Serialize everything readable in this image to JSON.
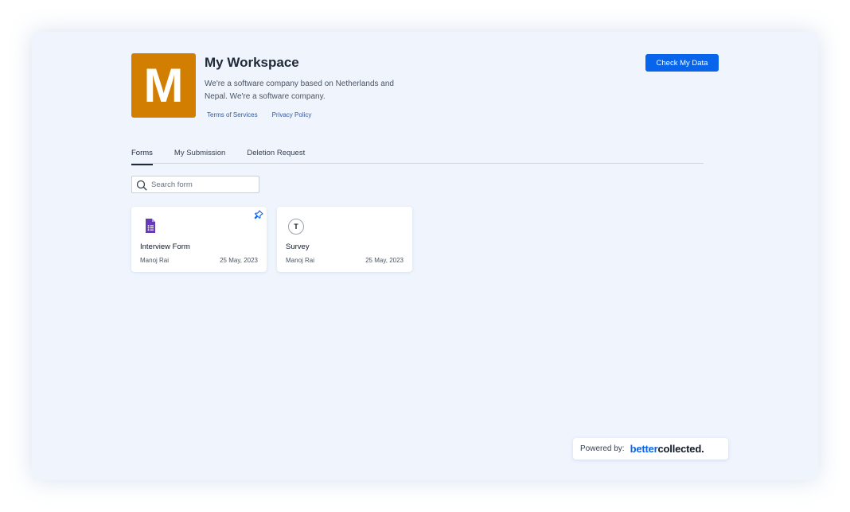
{
  "workspace": {
    "logo_letter": "M",
    "title": "My Workspace",
    "description": "We're a software company based on Netherlands and Nepal. We're a software company.",
    "terms_link": "Terms of Services",
    "privacy_link": "Privacy Policy",
    "cta_label": "Check My Data",
    "logo_color": "#d27e00"
  },
  "tabs": [
    {
      "label": "Forms",
      "active": true
    },
    {
      "label": "My Submission",
      "active": false
    },
    {
      "label": "Deletion Request",
      "active": false
    }
  ],
  "search": {
    "placeholder": "Search form",
    "value": "",
    "icon": "search-icon"
  },
  "forms": [
    {
      "title": "Interview Form",
      "author": "Manoj Rai",
      "date": "25 May, 2023",
      "provider_icon": "google-forms-icon",
      "pinned": true
    },
    {
      "title": "Survey",
      "author": "Manoj Rai",
      "date": "25 May, 2023",
      "provider_icon": "typeform-icon",
      "provider_letter": "T",
      "pinned": false
    }
  ],
  "footer": {
    "powered_label": "Powered by:",
    "brand_part1": "better",
    "brand_part2": "collected."
  },
  "colors": {
    "accent": "#0764eb",
    "background": "#eff4fd",
    "google_forms": "#673ab7"
  }
}
